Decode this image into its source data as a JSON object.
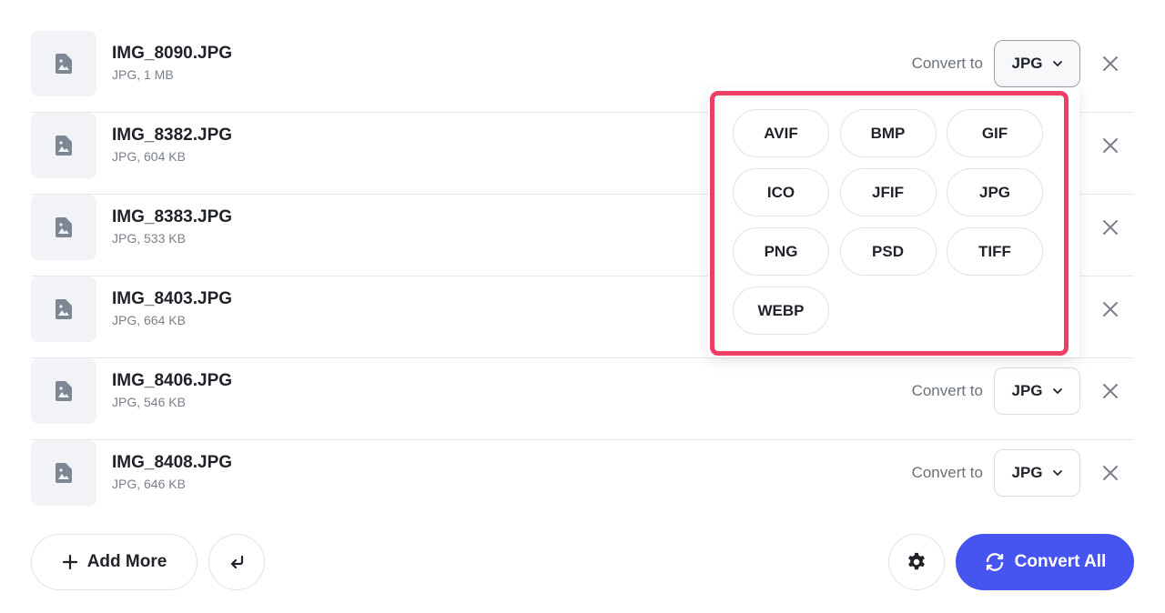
{
  "files": [
    {
      "name": "IMG_8090.JPG",
      "meta": "JPG, 1 MB",
      "show_convert": true
    },
    {
      "name": "IMG_8382.JPG",
      "meta": "JPG, 604 KB",
      "show_convert": false
    },
    {
      "name": "IMG_8383.JPG",
      "meta": "JPG, 533 KB",
      "show_convert": false
    },
    {
      "name": "IMG_8403.JPG",
      "meta": "JPG, 664 KB",
      "show_convert": false
    },
    {
      "name": "IMG_8406.JPG",
      "meta": "JPG, 546 KB",
      "show_convert": true
    },
    {
      "name": "IMG_8408.JPG",
      "meta": "JPG, 646 KB",
      "show_convert": true
    }
  ],
  "convert_label": "Convert to",
  "selected_format": "JPG",
  "format_options": [
    "AVIF",
    "BMP",
    "GIF",
    "ICO",
    "JFIF",
    "JPG",
    "PNG",
    "PSD",
    "TIFF",
    "WEBP"
  ],
  "footer": {
    "add_more": "Add More",
    "convert_all": "Convert All"
  },
  "colors": {
    "accent": "#4654f0",
    "highlight": "#ee3e64"
  }
}
